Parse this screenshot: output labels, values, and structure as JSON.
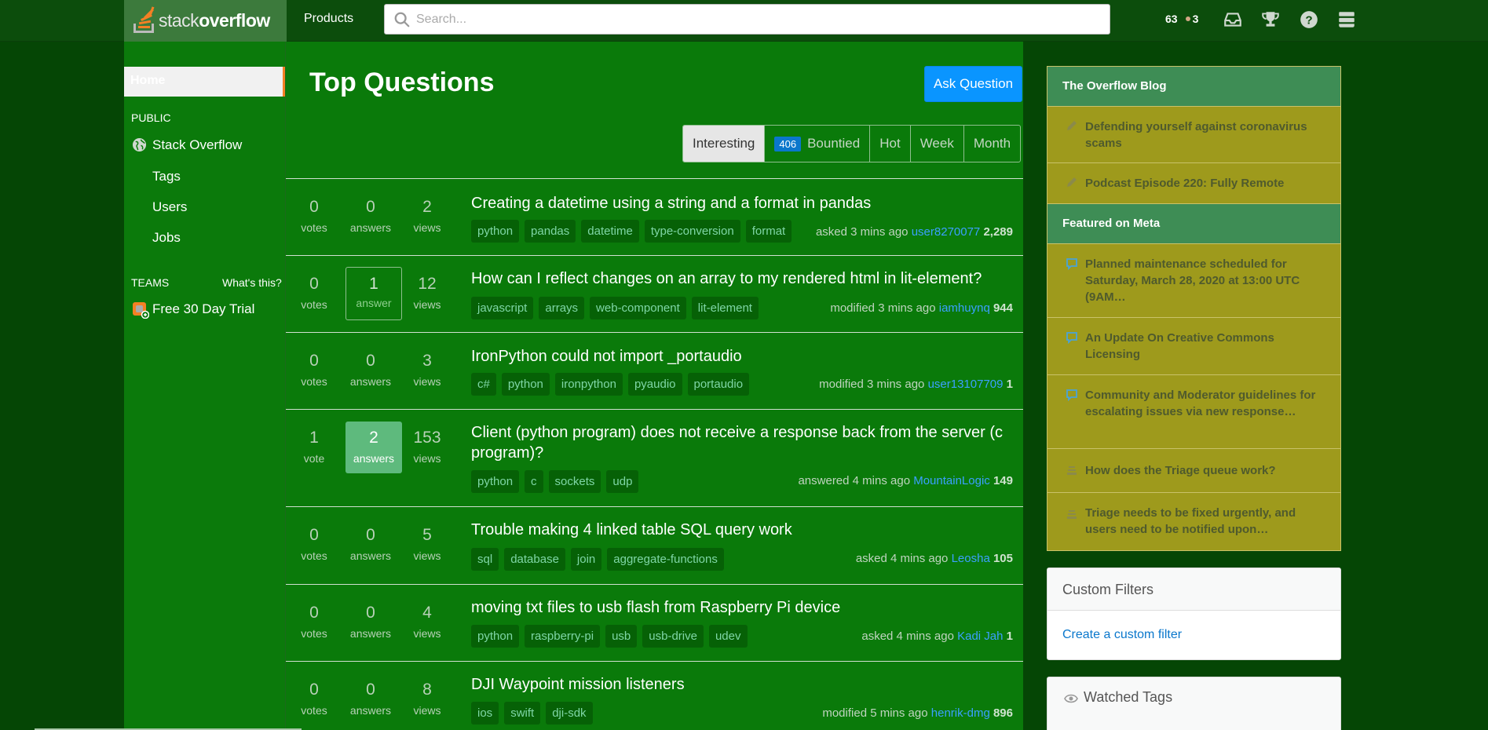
{
  "header": {
    "logo_light": "stack",
    "logo_bold": "overflow",
    "products": "Products",
    "search_placeholder": "Search...",
    "reputation": "63",
    "bronze": "3"
  },
  "sidebar": {
    "home": "Home",
    "public_label": "PUBLIC",
    "stack_overflow": "Stack Overflow",
    "tags": "Tags",
    "users": "Users",
    "jobs": "Jobs",
    "teams_label": "TEAMS",
    "whats_this": "What's this?",
    "trial": "Free 30 Day Trial"
  },
  "main": {
    "title": "Top Questions",
    "ask_button": "Ask Question",
    "tabs": [
      {
        "label": "Interesting"
      },
      {
        "label": "Bountied",
        "badge": "406"
      },
      {
        "label": "Hot"
      },
      {
        "label": "Week"
      },
      {
        "label": "Month"
      }
    ],
    "questions": [
      {
        "votes": "0",
        "votes_label": "votes",
        "answers": "0",
        "answers_label": "answers",
        "views": "2",
        "views_label": "views",
        "title": "Creating a datetime using a string and a format in pandas",
        "tags": [
          "python",
          "pandas",
          "datetime",
          "type-conversion",
          "format"
        ],
        "action": "asked 3 mins ago",
        "user": "user8270077",
        "score": "2,289"
      },
      {
        "votes": "0",
        "votes_label": "votes",
        "answers": "1",
        "answers_label": "answer",
        "views": "12",
        "views_label": "views",
        "title": "How can I reflect changes on an array to my rendered html in lit-element?",
        "tags": [
          "javascript",
          "arrays",
          "web-component",
          "lit-element"
        ],
        "action": "modified 3 mins ago",
        "user": "iamhuynq",
        "score": "944"
      },
      {
        "votes": "0",
        "votes_label": "votes",
        "answers": "0",
        "answers_label": "answers",
        "views": "3",
        "views_label": "views",
        "title": "IronPython could not import _portaudio",
        "tags": [
          "c#",
          "python",
          "ironpython",
          "pyaudio",
          "portaudio"
        ],
        "action": "modified 3 mins ago",
        "user": "user13107709",
        "score": "1"
      },
      {
        "votes": "1",
        "votes_label": "vote",
        "answers": "2",
        "answers_label": "answers",
        "views": "153",
        "views_label": "views",
        "title": "Client (python program) does not receive a response back from the server (c program)?",
        "tags": [
          "python",
          "c",
          "sockets",
          "udp"
        ],
        "action": "answered 4 mins ago",
        "user": "MountainLogic",
        "score": "149"
      },
      {
        "votes": "0",
        "votes_label": "votes",
        "answers": "0",
        "answers_label": "answers",
        "views": "5",
        "views_label": "views",
        "title": "Trouble making 4 linked table SQL query work",
        "tags": [
          "sql",
          "database",
          "join",
          "aggregate-functions"
        ],
        "action": "asked 4 mins ago",
        "user": "Leosha",
        "score": "105"
      },
      {
        "votes": "0",
        "votes_label": "votes",
        "answers": "0",
        "answers_label": "answers",
        "views": "4",
        "views_label": "views",
        "title": "moving txt files to usb flash from Raspberry Pi device",
        "tags": [
          "python",
          "raspberry-pi",
          "usb",
          "usb-drive",
          "udev"
        ],
        "action": "asked 4 mins ago",
        "user": "Kadi Jah",
        "score": "1"
      },
      {
        "votes": "0",
        "votes_label": "votes",
        "answers": "0",
        "answers_label": "answers",
        "views": "8",
        "views_label": "views",
        "title": "DJI Waypoint mission listeners",
        "tags": [
          "ios",
          "swift",
          "dji-sdk"
        ],
        "action": "modified 5 mins ago",
        "user": "henrik-dmg",
        "score": "896"
      }
    ]
  },
  "right": {
    "blog_title": "The Overflow Blog",
    "blog_items": [
      "Defending yourself against coronavirus scams",
      "Podcast Episode 220: Fully Remote"
    ],
    "meta_title": "Featured on Meta",
    "meta_items": [
      "Planned maintenance scheduled for Saturday, March 28, 2020 at 13:00 UTC (9AM…",
      "An Update On Creative Commons Licensing",
      "Community and Moderator guidelines for escalating issues via new response…",
      "How does the Triage queue work?",
      "Triage needs to be fixed urgently, and users need to be notified upon…"
    ],
    "custom_filters_title": "Custom Filters",
    "custom_filters_link": "Create a custom filter",
    "watched_tags_title": "Watched Tags"
  }
}
